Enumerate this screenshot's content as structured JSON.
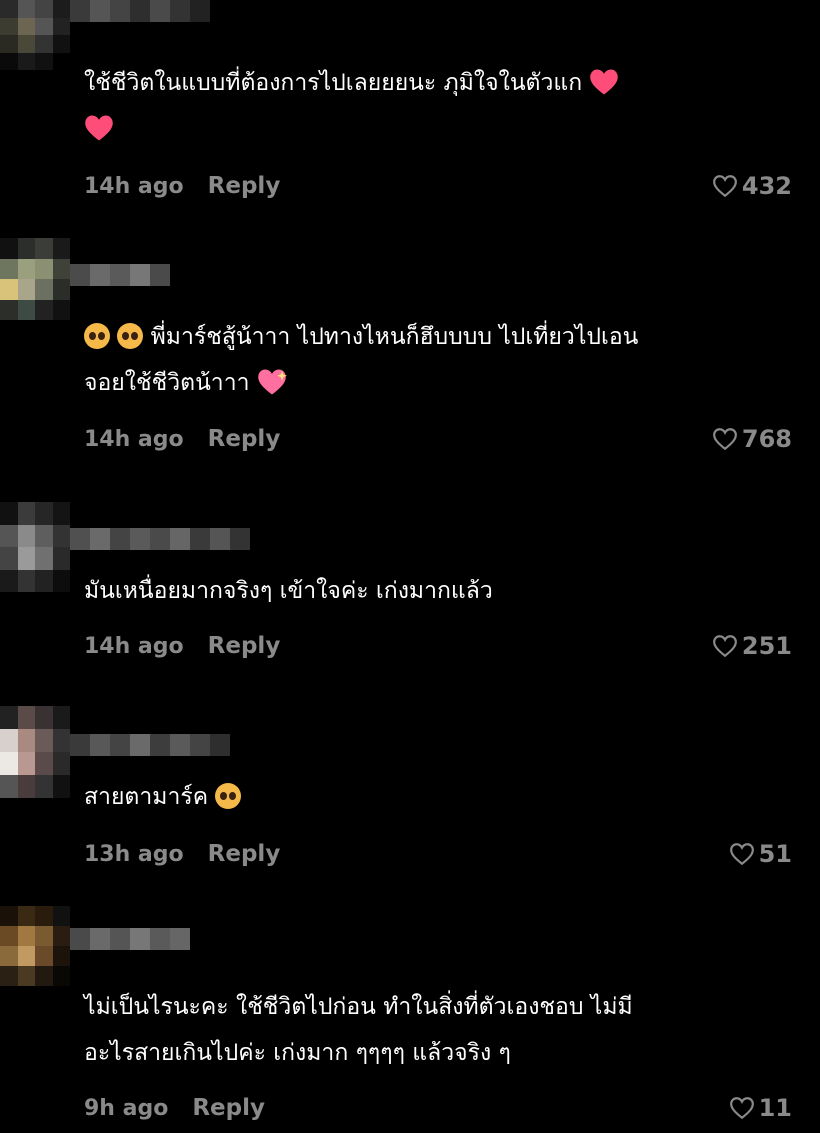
{
  "colors": {
    "background": "#000000",
    "text": "#ffffff",
    "meta": "#8a8a8a",
    "heart": "#ff4d7a"
  },
  "comments": [
    {
      "lines": [
        "ใช้ชีวิตในแบบที่ต้องการไปเลยยยนะ ภุมิใจในตัวแก",
        ""
      ],
      "time": "14h ago",
      "reply": "Reply",
      "likes": "432"
    },
    {
      "lines": [
        "พี่มาร์ชสู้น้าาา ไปทางไหนก็ฮึบบบบ ไปเที่ยวไปเอน",
        "จอยใช้ชีวิตน้าาา"
      ],
      "time": "14h ago",
      "reply": "Reply",
      "likes": "768"
    },
    {
      "lines": [
        "มันเหนื่อยมากจริงๆ เข้าใจค่ะ เก่งมากแล้ว"
      ],
      "time": "14h ago",
      "reply": "Reply",
      "likes": "251"
    },
    {
      "lines": [
        "สายตามาร์ค"
      ],
      "time": "13h ago",
      "reply": "Reply",
      "likes": "51"
    },
    {
      "lines": [
        "ไม่เป็นไรนะคะ ใช้ชีวิตไปก่อน ทำในสิ่งที่ตัวเองชอบ ไม่มี",
        "อะไรสายเกินไปค่ะ เก่งมาก ๆๆๆๆ แล้วจริง ๆ"
      ],
      "time": "9h ago",
      "reply": "Reply",
      "likes": "11"
    }
  ]
}
